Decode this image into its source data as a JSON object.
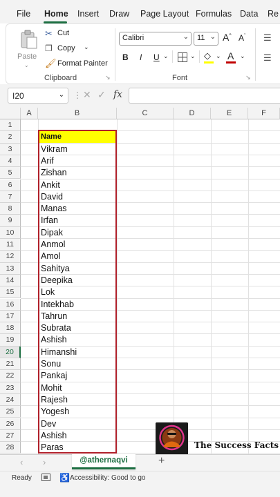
{
  "menu": {
    "tabs": [
      {
        "label": "File"
      },
      {
        "label": "Home"
      },
      {
        "label": "Insert"
      },
      {
        "label": "Draw"
      },
      {
        "label": "Page Layout"
      },
      {
        "label": "Formulas"
      },
      {
        "label": "Data"
      },
      {
        "label": "Re"
      }
    ]
  },
  "ribbon": {
    "paste_label": "Paste",
    "cut_label": "Cut",
    "copy_label": "Copy",
    "format_painter_label": "Format Painter",
    "clipboard_group": "Clipboard",
    "font_name": "Calibri",
    "font_size": "11",
    "font_group": "Font",
    "bold_label": "B",
    "italic_label": "I",
    "underline_label": "U",
    "grow_font": "A",
    "shrink_font": "A",
    "font_color_label": "A",
    "font_color": "#c00000",
    "fill_color": "#ffff00"
  },
  "formula_bar": {
    "name_box": "I20",
    "fx_label": "fx",
    "formula_value": ""
  },
  "grid": {
    "columns": [
      "A",
      "B",
      "C",
      "D",
      "E",
      "F"
    ],
    "rows": [
      "1",
      "2",
      "3",
      "4",
      "5",
      "6",
      "7",
      "8",
      "9",
      "10",
      "11",
      "12",
      "13",
      "14",
      "15",
      "16",
      "17",
      "18",
      "19",
      "20",
      "21",
      "22",
      "23",
      "24",
      "25",
      "26",
      "27",
      "28"
    ],
    "selected_row": "20",
    "header_cell": "Name",
    "names": [
      "Vikram",
      "Arif",
      "Zishan",
      "Ankit",
      "David",
      "Manas",
      "Irfan",
      "Dipak",
      "Anmol",
      "Amol",
      "Sahitya",
      "Deepika",
      "Lok",
      "Intekhab",
      "Tahrun",
      "Subrata",
      "Ashish",
      "Himanshi",
      "Sonu",
      "Pankaj",
      "Mohit",
      "Rajesh",
      "Yogesh",
      "Dev",
      "Ashish",
      "Paras"
    ],
    "highlight_color": "#ffff00",
    "border_color": "#b0202a"
  },
  "sheets": {
    "active_tab": "@athernaqvi",
    "add_label": "+"
  },
  "status": {
    "ready": "Ready",
    "accessibility": "Accessibility: Good to go"
  },
  "watermark": {
    "text": "The Success Facts"
  }
}
